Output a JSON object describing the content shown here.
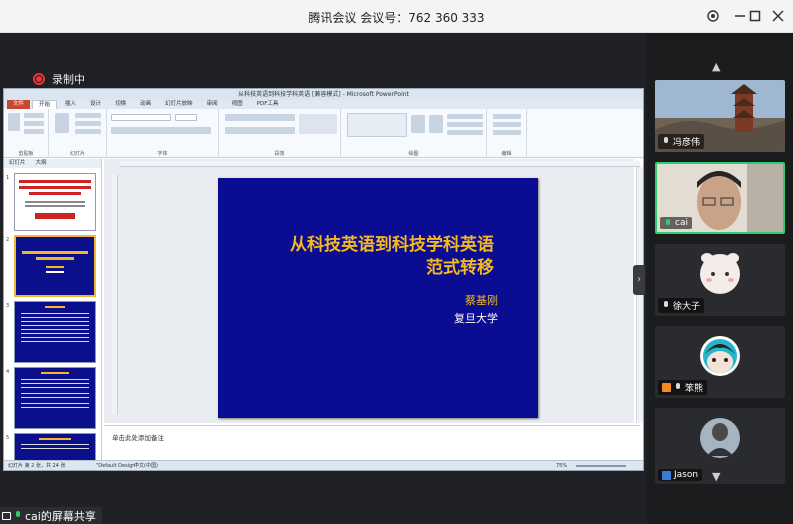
{
  "window": {
    "title": "腾讯会议 会议号：762 360 333",
    "controls": [
      "settings-icon",
      "minimize-icon",
      "maximize-icon",
      "close-icon"
    ]
  },
  "recording": {
    "label": "录制中"
  },
  "screen_share": {
    "label": "cai的屏幕共享"
  },
  "powerpoint": {
    "title": "从科技英语到科技学科英语 [兼容模式] - Microsoft PowerPoint",
    "tabs": [
      "文件",
      "开始",
      "插入",
      "设计",
      "切换",
      "动画",
      "幻灯片放映",
      "审阅",
      "视图",
      "PDF工具"
    ],
    "active_tab": "开始",
    "ribbon_groups": [
      "剪贴板",
      "幻灯片",
      "字体",
      "段落",
      "绘图",
      "编辑"
    ],
    "panel_tabs": [
      "幻灯片",
      "大纲"
    ],
    "thumbnail_numbers": [
      "1",
      "2",
      "3",
      "4",
      "5"
    ],
    "slide": {
      "title_line1": "从科技英语到科技学科英语",
      "title_line2": "范式转移",
      "author": "蔡基刚",
      "university": "复旦大学"
    },
    "notes_placeholder": "单击此处添加备注",
    "status": {
      "slide_info": "幻灯片 第 2 张，共 24 张",
      "theme": "\"Default Design\"",
      "language": "中文(中国)",
      "zoom": "75%"
    }
  },
  "participants": [
    {
      "name": "冯彦伟",
      "video": true,
      "muted": true
    },
    {
      "name": "cai",
      "video": true,
      "muted": false,
      "speaking": true
    },
    {
      "name": "徐大子",
      "video": false,
      "muted": true
    },
    {
      "name": "笨熊",
      "video": false,
      "muted": true
    },
    {
      "name": "Jason",
      "video": false,
      "muted": false
    }
  ],
  "colors": {
    "accent": "#2ecc71",
    "record": "#e33333",
    "slide_bg": "#0a0c92",
    "slide_title": "#f4b91e"
  }
}
